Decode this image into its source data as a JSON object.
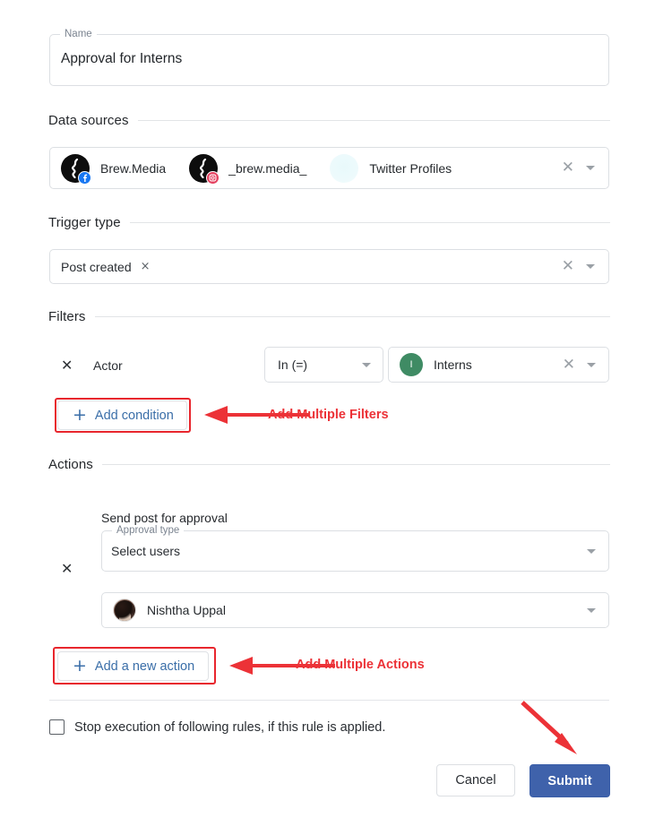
{
  "form": {
    "name_field": {
      "legend": "Name",
      "value": "Approval for Interns"
    },
    "sections": {
      "data_sources": "Data sources",
      "trigger_type": "Trigger type",
      "filters": "Filters",
      "actions": "Actions"
    },
    "data_sources": {
      "items": [
        {
          "label": "Brew.Media",
          "avatar": "brand-logo-avatar",
          "badge": "facebook-icon",
          "badge_glyph": "f",
          "badge_color": "#1877f2"
        },
        {
          "label": "_brew.media_",
          "avatar": "brand-logo-avatar",
          "badge": "instagram-icon",
          "badge_glyph": "▢",
          "badge_color": "#e4405f"
        },
        {
          "label": "Twitter Profiles",
          "avatar": "placeholder-avatar",
          "badge": "",
          "badge_glyph": "",
          "badge_color": "#e8f9fb"
        }
      ],
      "clear_icon": "✕",
      "dropdown_icon": "chevron-down-icon"
    },
    "trigger_type": {
      "tag_label": "Post created",
      "tag_remove_icon": "×",
      "clear_icon": "✕",
      "dropdown_icon": "chevron-down-icon"
    },
    "filters": {
      "remove_icon": "✕",
      "field_label": "Actor",
      "operator_value": "In (=)",
      "value_chip": {
        "initial": "I",
        "label": "Interns",
        "avatar_color": "#3f8b64"
      },
      "clear_icon": "✕",
      "add_condition_label": "Add condition",
      "add_plus_icon": "+"
    },
    "actions": {
      "remove_icon": "✕",
      "action_title": "Send post for approval",
      "approval_type": {
        "legend": "Approval type",
        "value": "Select users"
      },
      "user": {
        "name": "Nishtha Uppal",
        "avatar": "user-photo-avatar"
      },
      "add_action_label": "Add a new action",
      "add_plus_icon": "+"
    },
    "footer": {
      "stop_execution_label": "Stop execution of following rules, if this rule is applied.",
      "checkbox_checked": false,
      "cancel_label": "Cancel",
      "submit_label": "Submit"
    }
  },
  "annotations": {
    "filters_note": "Add Multiple Filters",
    "actions_note": "Add Multiple Actions",
    "color": "#ec3237"
  }
}
